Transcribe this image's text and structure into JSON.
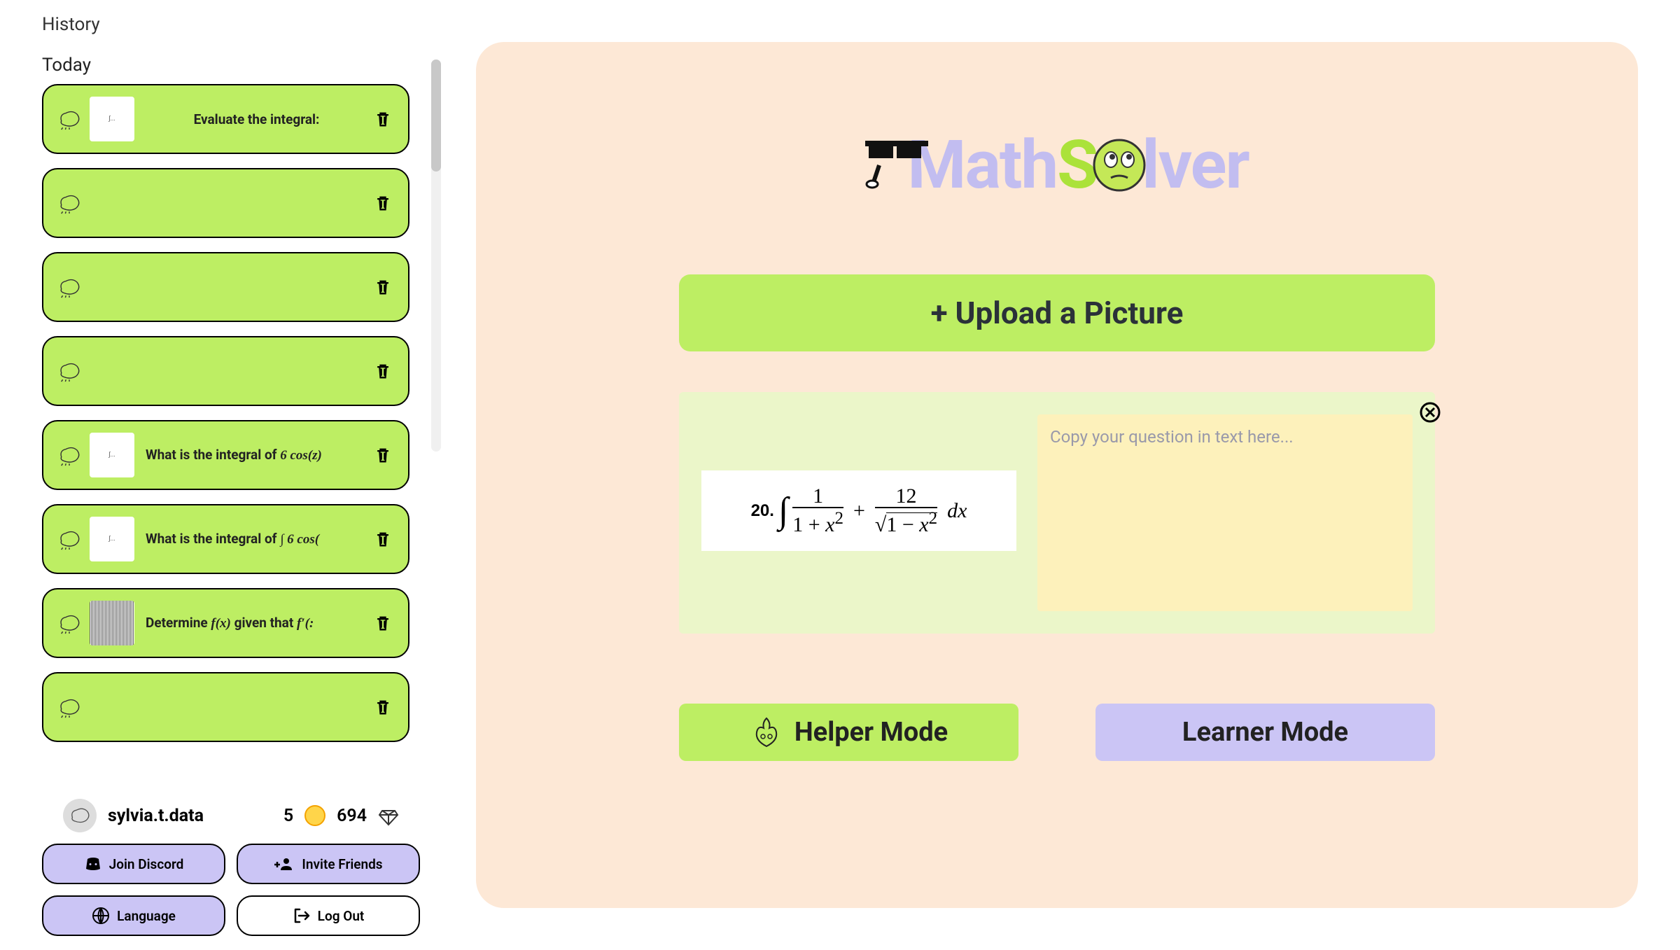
{
  "sidebar": {
    "historyTitle": "History",
    "todayLabel": "Today",
    "items": [
      {
        "text": "Evaluate the integral:",
        "hasThumb": true,
        "centered": true
      },
      {
        "text": "",
        "hasThumb": false
      },
      {
        "text": "",
        "hasThumb": false
      },
      {
        "text": "",
        "hasThumb": false
      },
      {
        "text": "What is the integral of 6 cos(z)",
        "hasThumb": true,
        "centered": false
      },
      {
        "text": "What is the integral of ∫ 6 cos(",
        "hasThumb": true,
        "centered": false
      },
      {
        "text": "Determine f(x) given that f′(:",
        "hasThumb": true,
        "centered": false
      },
      {
        "text": "",
        "hasThumb": false
      }
    ]
  },
  "user": {
    "name": "sylvia.t.data",
    "coins": "5",
    "gems": "694"
  },
  "footerButtons": {
    "discord": "Join Discord",
    "invite": "Invite Friends",
    "language": "Language",
    "logout": "Log Out"
  },
  "main": {
    "logoMath": "Math",
    "logoS": "S",
    "logoLver": "lver",
    "uploadLabel": "+ Upload a Picture",
    "textPlaceholder": "Copy your question in text here...",
    "problemNumber": "20.",
    "helperMode": "Helper Mode",
    "learnerMode": "Learner Mode"
  }
}
